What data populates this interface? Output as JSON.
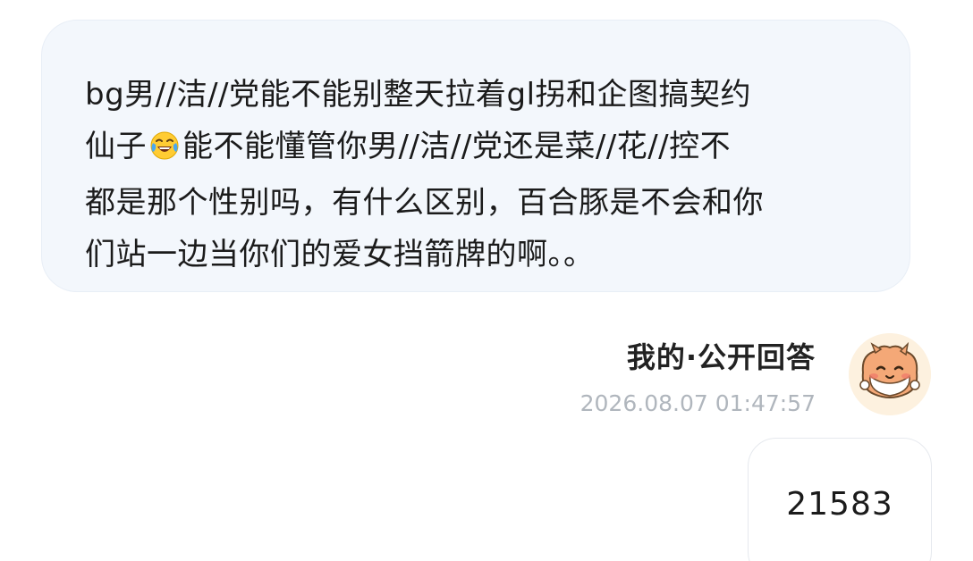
{
  "question": {
    "line1": "bg男//洁//党能不能别整天拉着gl拐和企图搞契约",
    "line2_before_emoji": "仙子",
    "emoji": "face-with-tears-of-joy",
    "line2_after_emoji": "能不能懂管你男//洁//党还是菜//花//控不",
    "line3": "都是那个性别吗，有什么区别，百合豚是不会和你",
    "line4": "们站一边当你们的爱女挡箭牌的啊。。"
  },
  "answer": {
    "title": "我的·公开回答",
    "timestamp": "2026.08.07 01:47:57",
    "content": "21583",
    "avatar": "hamster-avatar"
  },
  "colors": {
    "question_bg": "#f3f7fc",
    "timestamp": "#b0b6bd",
    "avatar_bg": "#fdf1df"
  }
}
